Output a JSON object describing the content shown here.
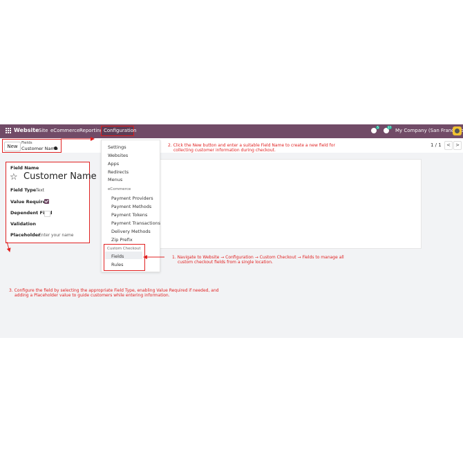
{
  "navbar": {
    "brand": "Website",
    "menu": [
      "Site",
      "eCommerce",
      "Reporting",
      "Configuration"
    ],
    "chat_badge": "5",
    "activity_badge": "37",
    "company": "My Company (San Francisco)"
  },
  "control_panel": {
    "new_label": "New",
    "breadcrumb_parent": "Fields",
    "breadcrumb_current": "Customer Name",
    "pager": "1 / 1",
    "prev": "<",
    "next": ">"
  },
  "dropdown": {
    "items": [
      "Settings",
      "Websites",
      "Apps",
      "Redirects",
      "Menus"
    ],
    "ecommerce_header": "eCommerce",
    "ecommerce_items": [
      "Payment Providers",
      "Payment Methods",
      "Payment Tokens",
      "Payment Transactions",
      "Delivery Methods",
      "Zip Prefix"
    ],
    "custom_header": "Custom Checkout",
    "custom_items": [
      "Fields",
      "Rules"
    ]
  },
  "zoom_form": {
    "field_name_label": "Field Name",
    "field_name_value": "Customer Name",
    "field_type_label": "Field Type",
    "field_type_value": "Text",
    "value_required_label": "Value Required",
    "dependent_field_label": "Dependent Field",
    "validation_label": "Validation",
    "placeholder_label": "Placeholder",
    "placeholder_value": "Enter your name"
  },
  "notes": {
    "note1_line1": "1. Navigate to Website → Configuration → Custom Checkout → Fields to manage all",
    "note1_line2": "custom checkout fields from a single location.",
    "note2_line1": "2. Click the New button and enter a suitable Field Name to create a new field for",
    "note2_line2": "collecting customer information during checkout.",
    "note3_line1": "3. Configure the field by selecting the appropriate Field Type, enabling Value Required if needed, and",
    "note3_line2": "adding a Placeholder value to guide customers while entering information."
  },
  "colors": {
    "navbar": "#714b67",
    "annotation": "#e02020",
    "checkbox": "#714b67"
  }
}
